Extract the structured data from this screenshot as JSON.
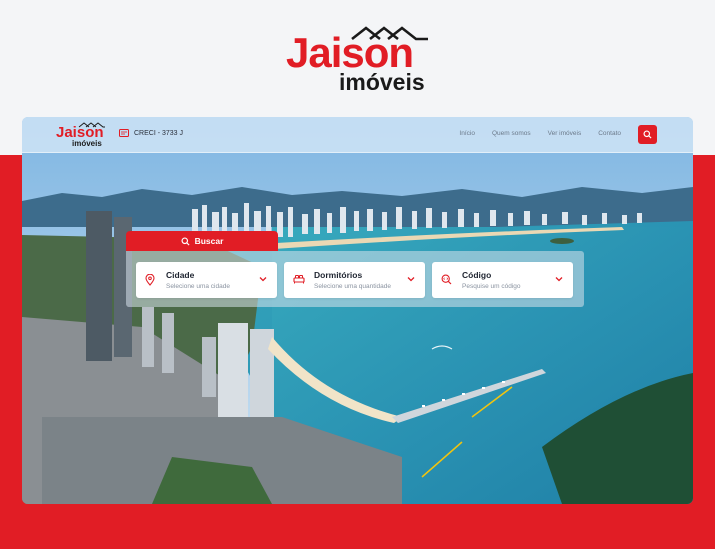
{
  "brand": {
    "name": "Jaison",
    "sub": "imóveis"
  },
  "nav": {
    "creci": "CRECI - 3733 J",
    "links": [
      "Início",
      "Quem somos",
      "Ver imóveis",
      "Contato"
    ]
  },
  "search": {
    "tab_label": "Buscar",
    "fields": [
      {
        "label": "Cidade",
        "placeholder": "Selecione uma cidade",
        "icon": "location-pin-icon"
      },
      {
        "label": "Dormitórios",
        "placeholder": "Selecione uma quantidade",
        "icon": "bed-icon"
      },
      {
        "label": "Código",
        "placeholder": "Pesquise um código",
        "icon": "code-search-icon"
      }
    ]
  },
  "colors": {
    "accent": "#e11d25",
    "text": "#1a1a1a"
  }
}
